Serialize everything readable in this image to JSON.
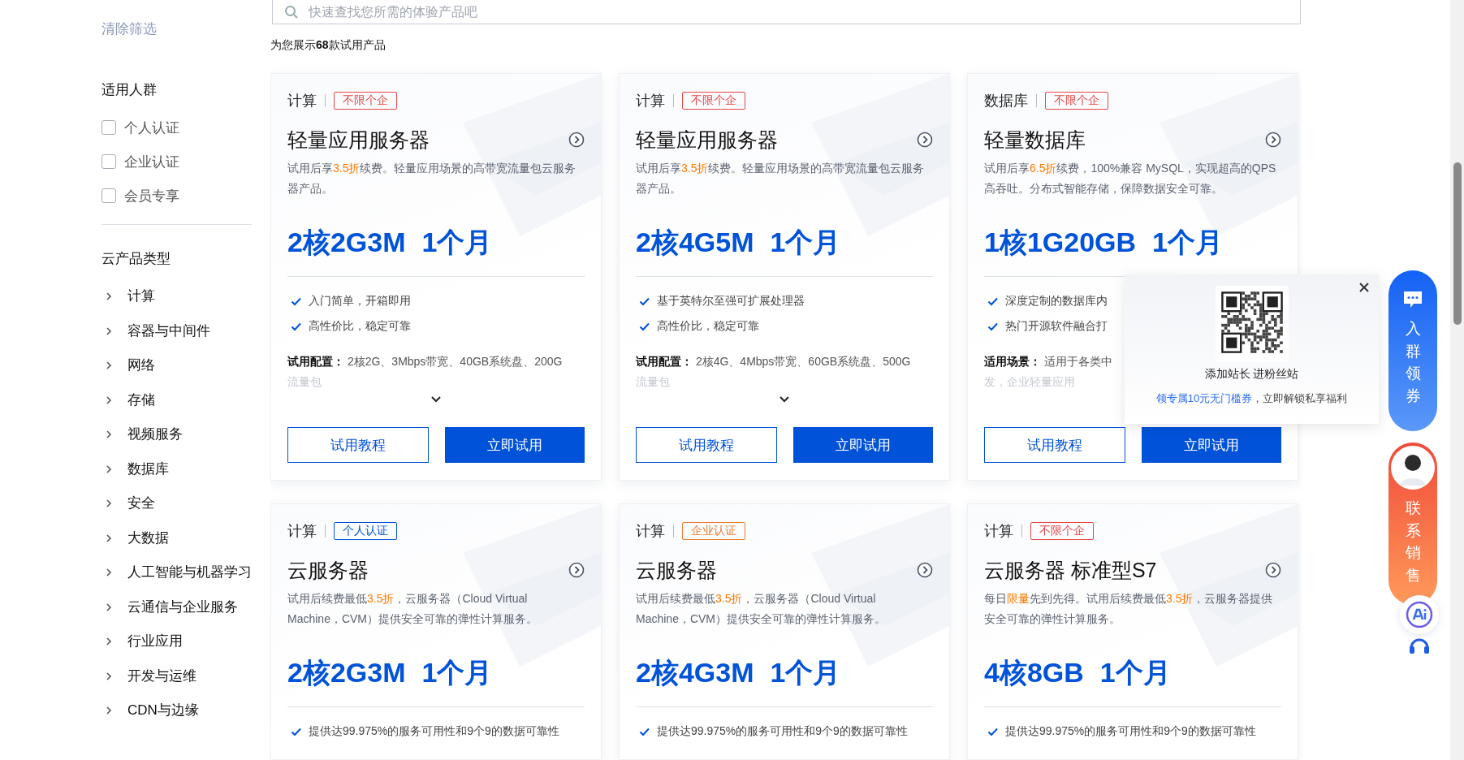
{
  "search": {
    "placeholder": "快速查找您所需的体验产品吧"
  },
  "sidebar": {
    "clear_filters": "清除筛选",
    "audience": {
      "title": "适用人群",
      "options": [
        {
          "label": "个人认证",
          "checked": false
        },
        {
          "label": "企业认证",
          "checked": false
        },
        {
          "label": "会员专享",
          "checked": false
        }
      ]
    },
    "categories": {
      "title": "云产品类型",
      "items": [
        {
          "label": "计算",
          "expanded": false
        },
        {
          "label": "容器与中间件",
          "expanded": false
        },
        {
          "label": "网络",
          "expanded": false
        },
        {
          "label": "存储",
          "expanded": false
        },
        {
          "label": "视频服务",
          "expanded": false
        },
        {
          "label": "数据库",
          "expanded": false
        },
        {
          "label": "安全",
          "expanded": false
        },
        {
          "label": "大数据",
          "expanded": false
        },
        {
          "label": "人工智能与机器学习",
          "expanded": false
        },
        {
          "label": "云通信与企业服务",
          "expanded": false
        },
        {
          "label": "行业应用",
          "expanded": false
        },
        {
          "label": "开发与运维",
          "expanded": false
        },
        {
          "label": "CDN与边缘",
          "expanded": false
        }
      ]
    }
  },
  "result_count": "为您展示**68**款试用产品",
  "cards": [
    {
      "category": "计算",
      "tag": {
        "label": "不限个企",
        "color": "#e54545"
      },
      "title": "轻量应用服务器",
      "description": [
        {
          "text": "试用后享"
        },
        {
          "text": "3.5折",
          "highlight": true
        },
        {
          "text": "续费。轻量应用场景的高带宽流量包云服务器产品。"
        }
      ],
      "spec": "2核2G3M",
      "duration": "1个月",
      "features": [
        "入门简单，开箱即用",
        "高性价比，稳定可靠"
      ],
      "config": [
        "**试用配置：** 2核2G、3Mbps带宽、40GB系统盘、200G",
        "流量包"
      ],
      "show_more": true,
      "buttons": {
        "tutorial": "试用教程",
        "try": "立即试用"
      }
    },
    {
      "category": "计算",
      "tag": {
        "label": "不限个企",
        "color": "#e54545"
      },
      "title": "轻量应用服务器",
      "description": [
        {
          "text": "试用后享"
        },
        {
          "text": "3.5折",
          "highlight": true
        },
        {
          "text": "续费。轻量应用场景的高带宽流量包云服务器产品。"
        }
      ],
      "spec": "2核4G5M",
      "duration": "1个月",
      "features": [
        "基于英特尔至强可扩展处理器",
        "高性价比，稳定可靠"
      ],
      "config": [
        "**试用配置：** 2核4G、4Mbps带宽、60GB系统盘、500G",
        "流量包"
      ],
      "show_more": true,
      "buttons": {
        "tutorial": "试用教程",
        "try": "立即试用"
      }
    },
    {
      "category": "数据库",
      "tag": {
        "label": "不限个企",
        "color": "#e54545"
      },
      "title": "轻量数据库",
      "description": [
        {
          "text": "试用后享"
        },
        {
          "text": "6.5折",
          "highlight": true
        },
        {
          "text": "续费，100%兼容 MySQL，实现超高的QPS高吞吐。分布式智能存储，保障数据安全可靠。"
        }
      ],
      "spec": "1核1G20GB",
      "duration": "1个月",
      "features": [
        "深度定制的数据库内",
        "热门开源软件融合打"
      ],
      "config": [
        "**适用场景：** 适用于各类中",
        "发，企业轻量应用"
      ],
      "show_more": false,
      "buttons": {
        "tutorial": "试用教程",
        "try": "立即试用"
      }
    },
    {
      "category": "计算",
      "tag": {
        "label": "个人认证",
        "color": "#0052d9"
      },
      "title": "云服务器",
      "description": [
        {
          "text": "试用后续费最低"
        },
        {
          "text": "3.5折",
          "highlight": true
        },
        {
          "text": "，云服务器（Cloud Virtual Machine，CVM）提供安全可靠的弹性计算服务。"
        }
      ],
      "spec": "2核2G3M",
      "duration": "1个月",
      "features": [
        "提供达99.975%的服务可用性和9个9的数据可靠性"
      ]
    },
    {
      "category": "计算",
      "tag": {
        "label": "企业认证",
        "color": "#ed7b2f"
      },
      "title": "云服务器",
      "description": [
        {
          "text": "试用后续费最低"
        },
        {
          "text": "3.5折",
          "highlight": true
        },
        {
          "text": "，云服务器（Cloud Virtual Machine，CVM）提供安全可靠的弹性计算服务。"
        }
      ],
      "spec": "2核4G3M",
      "duration": "1个月",
      "features": [
        "提供达99.975%的服务可用性和9个9的数据可靠性"
      ]
    },
    {
      "category": "计算",
      "tag": {
        "label": "不限个企",
        "color": "#e54545"
      },
      "title": "云服务器 标准型S7",
      "description": [
        {
          "text": "每日"
        },
        {
          "text": "限量",
          "highlight": true
        },
        {
          "text": "先到先得。试用后续费最低"
        },
        {
          "text": "3.5折",
          "highlight": true
        },
        {
          "text": "，云服务器提供安全可靠的弹性计算服务。"
        }
      ],
      "spec": "4核8GB",
      "duration": "1个月",
      "features": [
        "提供达99.975%的服务可用性和9个9的数据可靠性"
      ]
    }
  ],
  "popup": {
    "caption": "添加站长 进粉丝站",
    "offer": [
      {
        "text": "领专属10元无门槛券",
        "highlight": true
      },
      {
        "text": "，立即解锁私享福利"
      }
    ]
  },
  "floating": {
    "group_coupon": "入群领券",
    "contact_sales": "联系销售"
  }
}
